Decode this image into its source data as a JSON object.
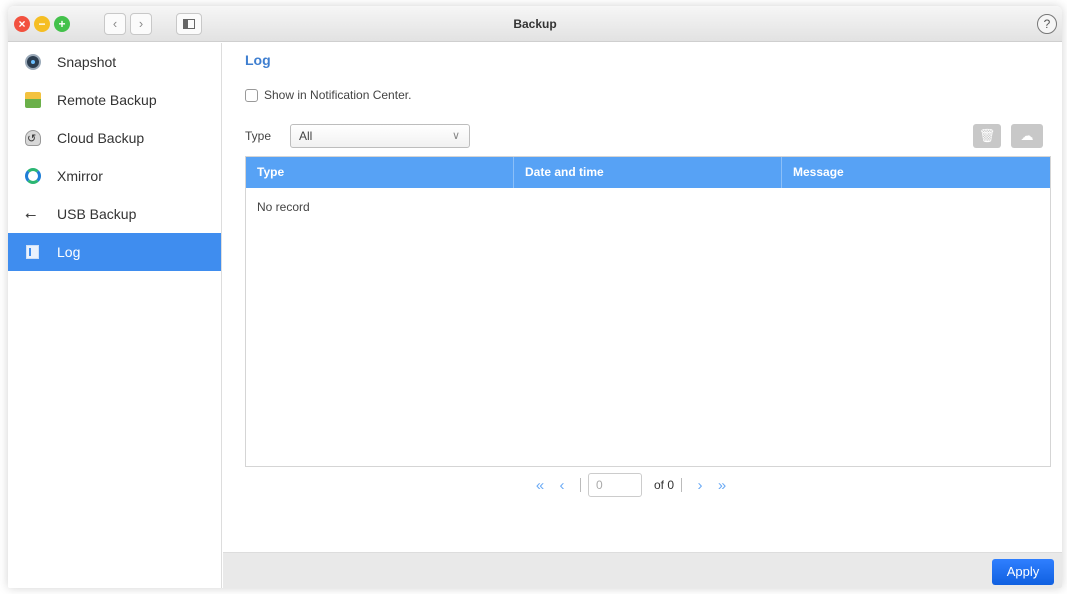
{
  "window": {
    "title": "Backup",
    "help_glyph": "?",
    "traffic": {
      "close": "×",
      "minimize": "−",
      "maximize": "+"
    },
    "nav": {
      "back": "‹",
      "forward": "›"
    }
  },
  "sidebar": {
    "items": [
      {
        "label": "Snapshot",
        "icon": "snapshot-icon"
      },
      {
        "label": "Remote Backup",
        "icon": "remote-backup-icon"
      },
      {
        "label": "Cloud Backup",
        "icon": "cloud-backup-icon"
      },
      {
        "label": "Xmirror",
        "icon": "xmirror-icon"
      },
      {
        "label": "USB Backup",
        "icon": "usb-icon"
      },
      {
        "label": "Log",
        "icon": "log-icon",
        "active": true
      }
    ]
  },
  "main": {
    "title": "Log",
    "notification_label": "Show in Notification Center.",
    "filter": {
      "label": "Type",
      "value": "All",
      "chevron": "∨"
    },
    "toolbar": {
      "delete_glyph": "🗑",
      "export_glyph": "☁"
    },
    "table": {
      "columns": [
        "Type",
        "Date and time",
        "Message"
      ],
      "empty_text": "No record"
    },
    "pager": {
      "first": "«",
      "prev": "‹",
      "page_value": "0",
      "of_text": "of 0",
      "next": "›",
      "last": "»"
    }
  },
  "footer": {
    "apply_label": "Apply"
  },
  "colors": {
    "accent": "#3f8def",
    "table_header": "#57a2f5",
    "apply_button": "#1f6ff0",
    "page_title": "#3f7fd0"
  }
}
